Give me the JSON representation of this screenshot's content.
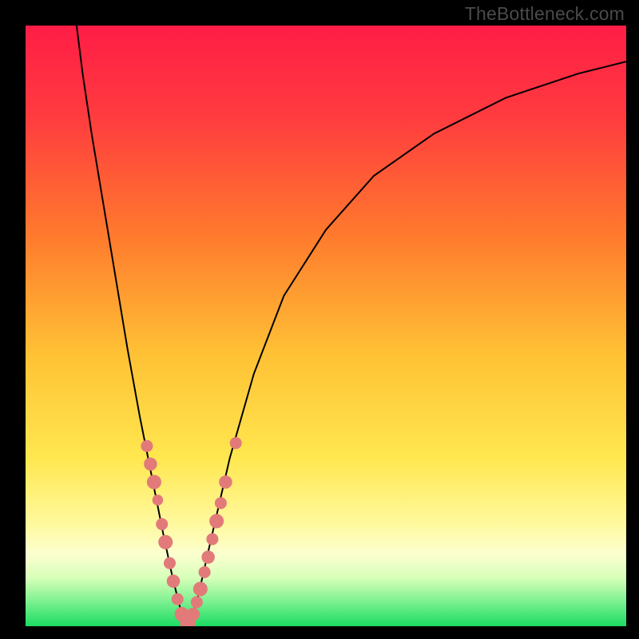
{
  "watermark": "TheBottleneck.com",
  "chart_data": {
    "type": "line",
    "title": "",
    "xlabel": "",
    "ylabel": "",
    "xlim": [
      0,
      100
    ],
    "ylim": [
      0,
      100
    ],
    "grid": false,
    "legend": false,
    "background_gradient_stops": [
      {
        "offset": 0.0,
        "color": "#ff1d46"
      },
      {
        "offset": 0.15,
        "color": "#ff3b3f"
      },
      {
        "offset": 0.35,
        "color": "#ff7a2d"
      },
      {
        "offset": 0.55,
        "color": "#ffc235"
      },
      {
        "offset": 0.72,
        "color": "#ffe74f"
      },
      {
        "offset": 0.83,
        "color": "#fff99e"
      },
      {
        "offset": 0.88,
        "color": "#fcffd0"
      },
      {
        "offset": 0.92,
        "color": "#d6ffb8"
      },
      {
        "offset": 0.96,
        "color": "#7af08f"
      },
      {
        "offset": 1.0,
        "color": "#1bdc63"
      }
    ],
    "series": [
      {
        "name": "left-curve",
        "stroke": "#000000",
        "points": [
          {
            "x": 8.5,
            "y": 100.0
          },
          {
            "x": 9.5,
            "y": 92.0
          },
          {
            "x": 11.0,
            "y": 82.0
          },
          {
            "x": 13.0,
            "y": 70.0
          },
          {
            "x": 15.0,
            "y": 58.0
          },
          {
            "x": 17.0,
            "y": 46.0
          },
          {
            "x": 19.0,
            "y": 35.0
          },
          {
            "x": 21.0,
            "y": 25.0
          },
          {
            "x": 23.0,
            "y": 15.0
          },
          {
            "x": 24.5,
            "y": 8.0
          },
          {
            "x": 26.0,
            "y": 2.0
          },
          {
            "x": 27.0,
            "y": 0.0
          }
        ]
      },
      {
        "name": "right-curve",
        "stroke": "#000000",
        "points": [
          {
            "x": 27.0,
            "y": 0.0
          },
          {
            "x": 28.5,
            "y": 4.0
          },
          {
            "x": 31.0,
            "y": 15.0
          },
          {
            "x": 34.0,
            "y": 28.0
          },
          {
            "x": 38.0,
            "y": 42.0
          },
          {
            "x": 43.0,
            "y": 55.0
          },
          {
            "x": 50.0,
            "y": 66.0
          },
          {
            "x": 58.0,
            "y": 75.0
          },
          {
            "x": 68.0,
            "y": 82.0
          },
          {
            "x": 80.0,
            "y": 88.0
          },
          {
            "x": 92.0,
            "y": 92.0
          },
          {
            "x": 100.0,
            "y": 94.0
          }
        ]
      }
    ],
    "marker_series": [
      {
        "name": "left-markers",
        "color": "#e27a7a",
        "points": [
          {
            "x": 20.2,
            "y": 30.0,
            "r": 1.0
          },
          {
            "x": 20.8,
            "y": 27.0,
            "r": 1.1
          },
          {
            "x": 21.4,
            "y": 24.0,
            "r": 1.2
          },
          {
            "x": 22.0,
            "y": 21.0,
            "r": 0.9
          },
          {
            "x": 22.7,
            "y": 17.0,
            "r": 1.0
          },
          {
            "x": 23.3,
            "y": 14.0,
            "r": 1.2
          },
          {
            "x": 24.0,
            "y": 10.5,
            "r": 1.0
          },
          {
            "x": 24.6,
            "y": 7.5,
            "r": 1.1
          },
          {
            "x": 25.3,
            "y": 4.5,
            "r": 1.0
          },
          {
            "x": 26.0,
            "y": 2.0,
            "r": 1.2
          },
          {
            "x": 26.7,
            "y": 0.5,
            "r": 1.0
          }
        ]
      },
      {
        "name": "right-markers",
        "color": "#e27a7a",
        "points": [
          {
            "x": 27.3,
            "y": 0.5,
            "r": 1.0
          },
          {
            "x": 27.9,
            "y": 2.0,
            "r": 1.1
          },
          {
            "x": 28.5,
            "y": 4.0,
            "r": 1.0
          },
          {
            "x": 29.1,
            "y": 6.2,
            "r": 1.2
          },
          {
            "x": 29.8,
            "y": 9.0,
            "r": 1.0
          },
          {
            "x": 30.4,
            "y": 11.5,
            "r": 1.1
          },
          {
            "x": 31.1,
            "y": 14.5,
            "r": 1.0
          },
          {
            "x": 31.8,
            "y": 17.5,
            "r": 1.2
          },
          {
            "x": 32.5,
            "y": 20.5,
            "r": 1.0
          },
          {
            "x": 33.3,
            "y": 24.0,
            "r": 1.1
          },
          {
            "x": 35.0,
            "y": 30.5,
            "r": 1.0
          }
        ]
      }
    ]
  }
}
